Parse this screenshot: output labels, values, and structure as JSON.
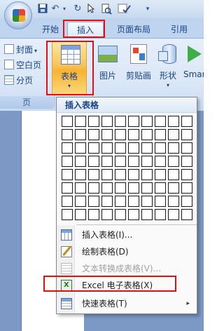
{
  "qat": {
    "icons": [
      "office-button",
      "save-icon",
      "undo-icon",
      "redo-icon",
      "cursor-icon",
      "print-preview-icon",
      "spelling-icon",
      "customize-dropdown-icon"
    ],
    "undo_glyph": "↶",
    "redo_glyph": "↻",
    "dropdown_glyph": "▾"
  },
  "tabs": [
    {
      "label": "开始"
    },
    {
      "label": "插入",
      "active": true
    },
    {
      "label": "页面布局"
    },
    {
      "label": "引用"
    }
  ],
  "ribbon": {
    "pages_group": {
      "items": [
        {
          "label": "封面",
          "has_dropdown": true
        },
        {
          "label": "空白页"
        },
        {
          "label": "分页"
        }
      ],
      "caption": "页"
    },
    "table_button": {
      "label": "表格",
      "caret": "▾"
    },
    "picture_button": {
      "label": "图片"
    },
    "clipart_button": {
      "label": "剪贴画"
    },
    "shapes_button": {
      "label": "形状",
      "caret": "▾"
    },
    "smartart_button": {
      "label": "Smar"
    }
  },
  "menu": {
    "title": "插入表格",
    "grid": {
      "columns": 10,
      "rows": 8
    },
    "items": [
      {
        "label": "插入表格(I)...",
        "icon": "insert-table-icon",
        "enabled": true
      },
      {
        "label": "绘制表格(D)",
        "icon": "draw-table-icon",
        "enabled": true
      },
      {
        "label": "文本转换成表格(V)...",
        "icon": "text-to-table-icon",
        "enabled": false
      },
      {
        "label": "Excel 电子表格(X)",
        "icon": "excel-sheet-icon",
        "enabled": true
      },
      {
        "label": "快速表格(T)",
        "icon": "quick-table-icon",
        "enabled": true,
        "submenu": "▸"
      }
    ]
  },
  "colors": {
    "highlight_box": "#e01010",
    "accent": "#15428b",
    "ribbon_bg": "#dbe7f7"
  }
}
